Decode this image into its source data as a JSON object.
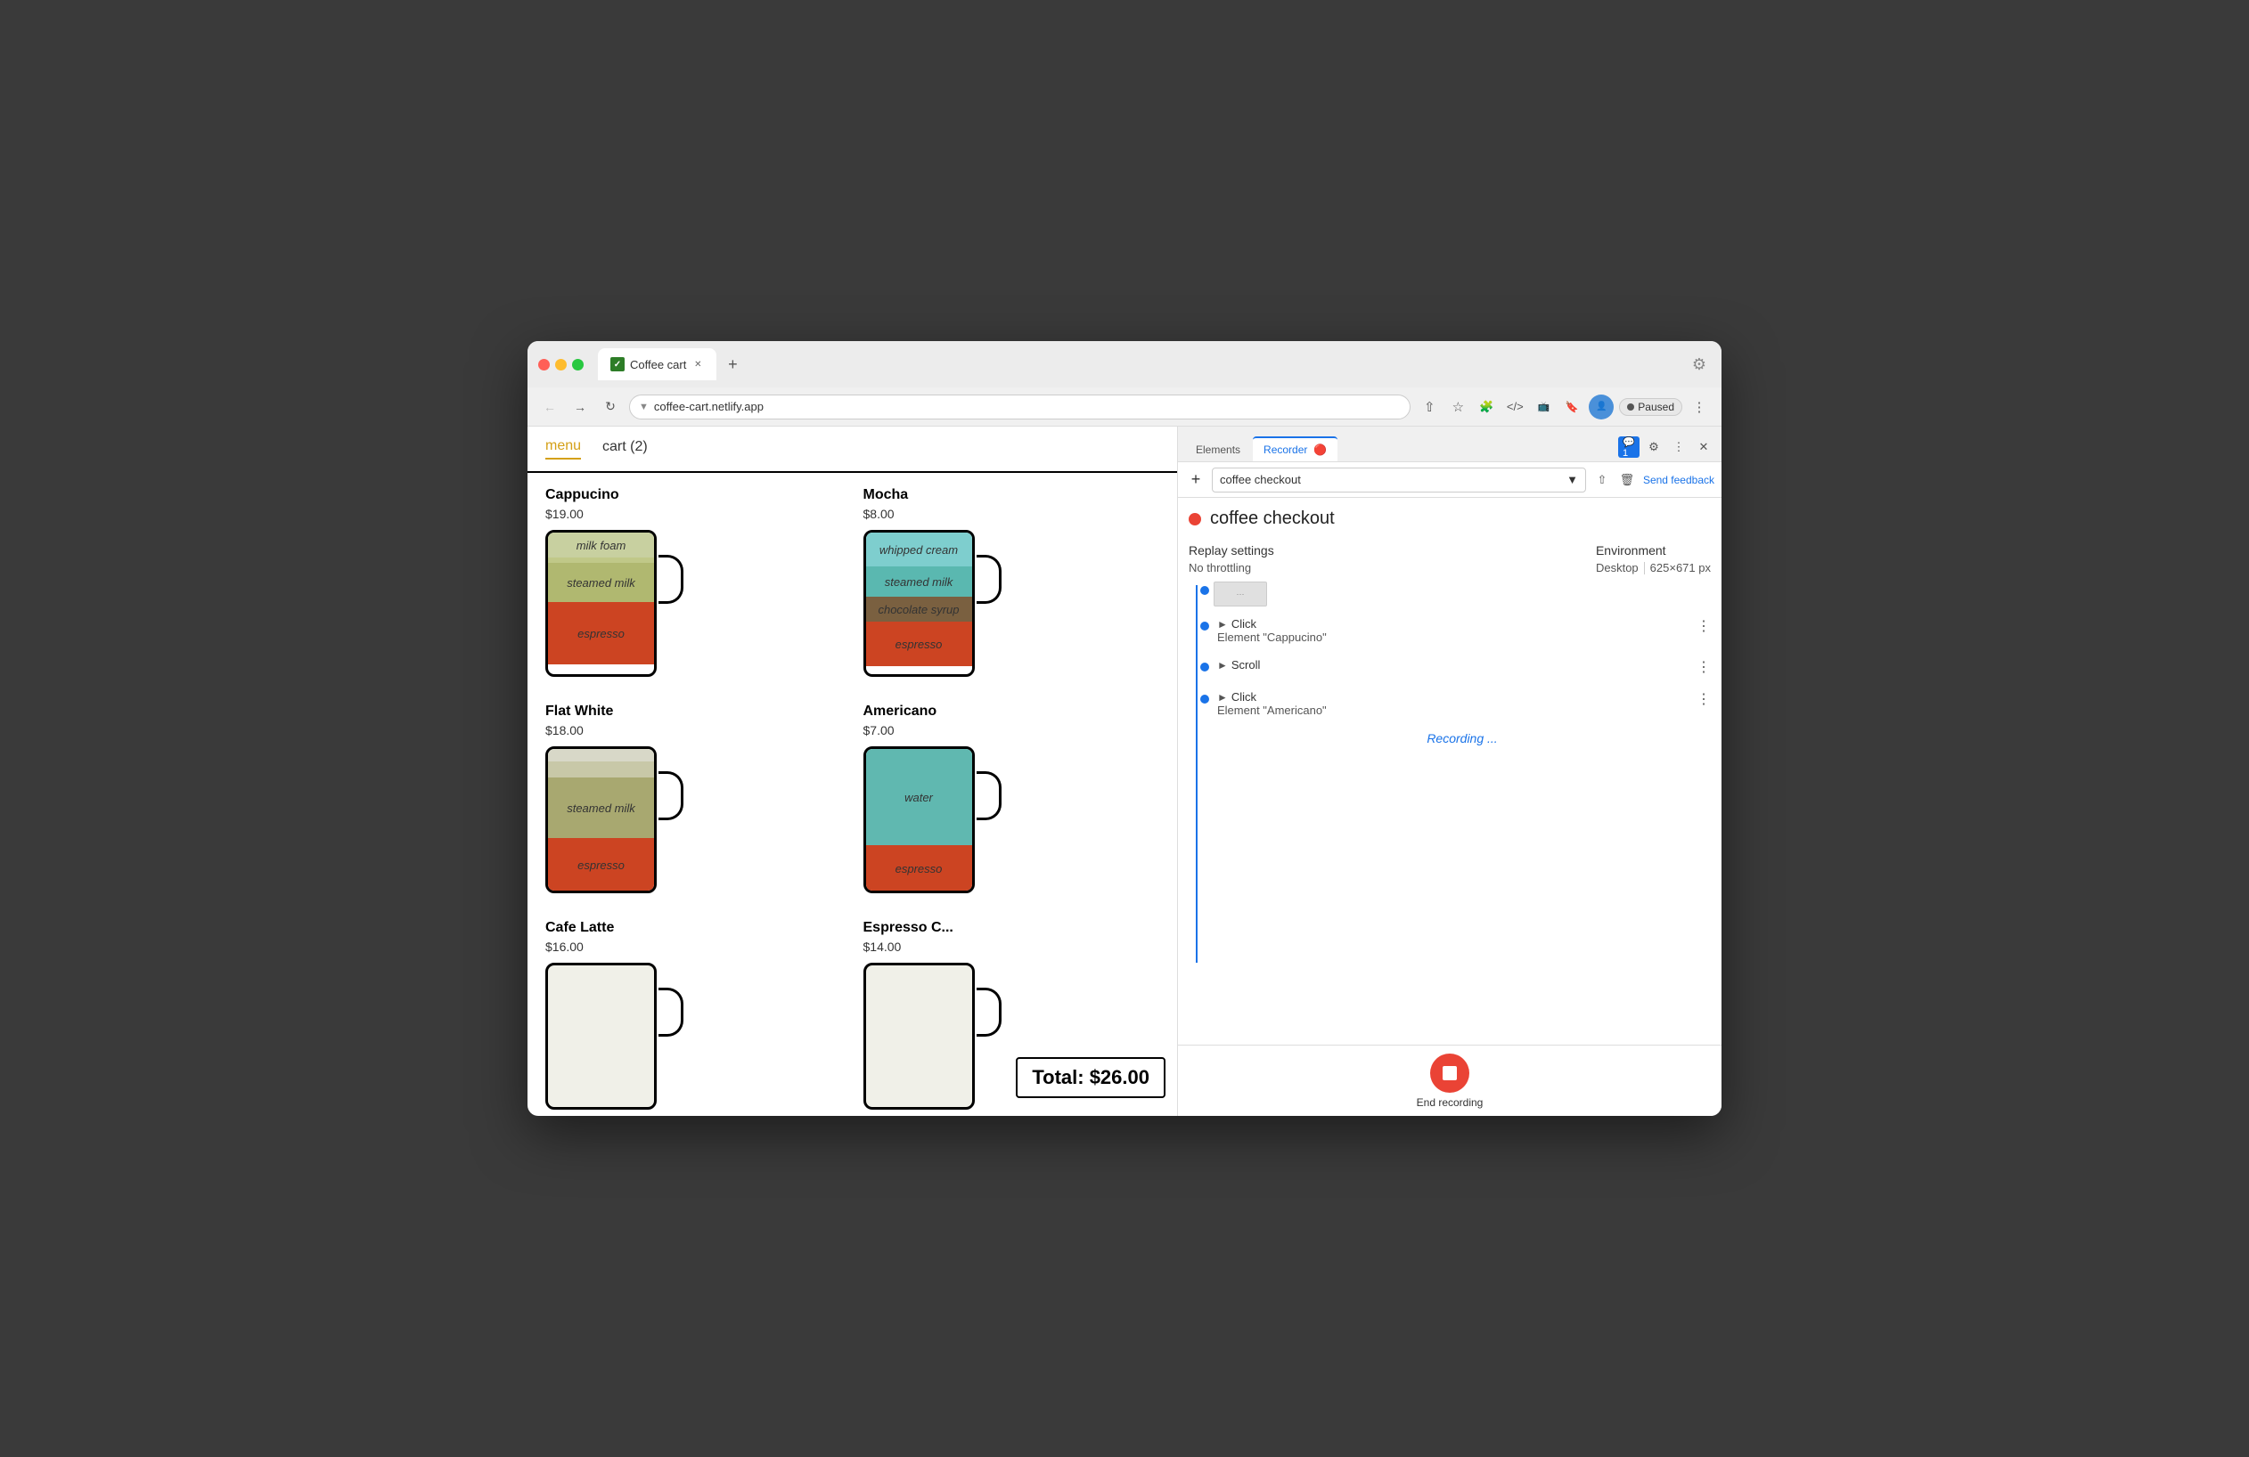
{
  "browser": {
    "tab_title": "Coffee cart",
    "url": "coffee-cart.netlify.app",
    "new_tab_label": "+",
    "paused_label": "Paused"
  },
  "nav": {
    "menu_label": "menu",
    "cart_label": "cart (2)"
  },
  "coffee_items": [
    {
      "name": "Cappucino",
      "price": "$19.00",
      "layers": [
        {
          "label": "milk foam",
          "color": "#c8d0a0",
          "height": 28
        },
        {
          "label": "",
          "color": "#c8c890",
          "height": 6
        },
        {
          "label": "steamed milk",
          "color": "#b0b870",
          "height": 44
        },
        {
          "label": "espresso",
          "color": "#cc4422",
          "height": 60
        }
      ]
    },
    {
      "name": "Mocha",
      "price": "$8.00",
      "layers": [
        {
          "label": "whipped cream",
          "color": "#7ecece",
          "height": 40
        },
        {
          "label": "steamed milk",
          "color": "#5ab0b0",
          "height": 36
        },
        {
          "label": "chocolate syrup",
          "color": "#7a6040",
          "height": 28
        },
        {
          "label": "espresso",
          "color": "#cc4422",
          "height": 44
        }
      ]
    },
    {
      "name": "Flat White",
      "price": "$18.00",
      "layers": [
        {
          "label": "",
          "color": "#d8d8c0",
          "height": 16
        },
        {
          "label": "",
          "color": "#c0c8a0",
          "height": 22
        },
        {
          "label": "steamed milk",
          "color": "#a8a878",
          "height": 70
        },
        {
          "label": "espresso",
          "color": "#cc4422",
          "height": 58
        }
      ]
    },
    {
      "name": "Americano",
      "price": "$7.00",
      "layers": [
        {
          "label": "water",
          "color": "#60b8b0",
          "height": 110
        },
        {
          "label": "espresso",
          "color": "#cc4422",
          "height": 50
        }
      ]
    },
    {
      "name": "Cafe Latte",
      "price": "$16.00",
      "layers": []
    },
    {
      "name": "Espresso C...",
      "price": "$14.00",
      "layers": []
    }
  ],
  "total": {
    "label": "Total: $26.00"
  },
  "devtools": {
    "tabs": [
      "Elements",
      "Recorder",
      ""
    ],
    "recorder_tab": "Recorder",
    "elements_tab": "Elements",
    "add_btn": "+",
    "recording_name": "coffee checkout",
    "send_feedback": "Send feedback",
    "replay_settings_label": "Replay settings",
    "no_throttling": "No throttling",
    "environment_label": "Environment",
    "environment_value": "Desktop",
    "environment_size": "625×671 px",
    "steps": [
      {
        "type": "Click",
        "detail": "Element \"Cappucino\""
      },
      {
        "type": "Scroll",
        "detail": ""
      },
      {
        "type": "Click",
        "detail": "Element \"Americano\""
      }
    ],
    "recording_status": "Recording ...",
    "end_recording_label": "End recording"
  }
}
